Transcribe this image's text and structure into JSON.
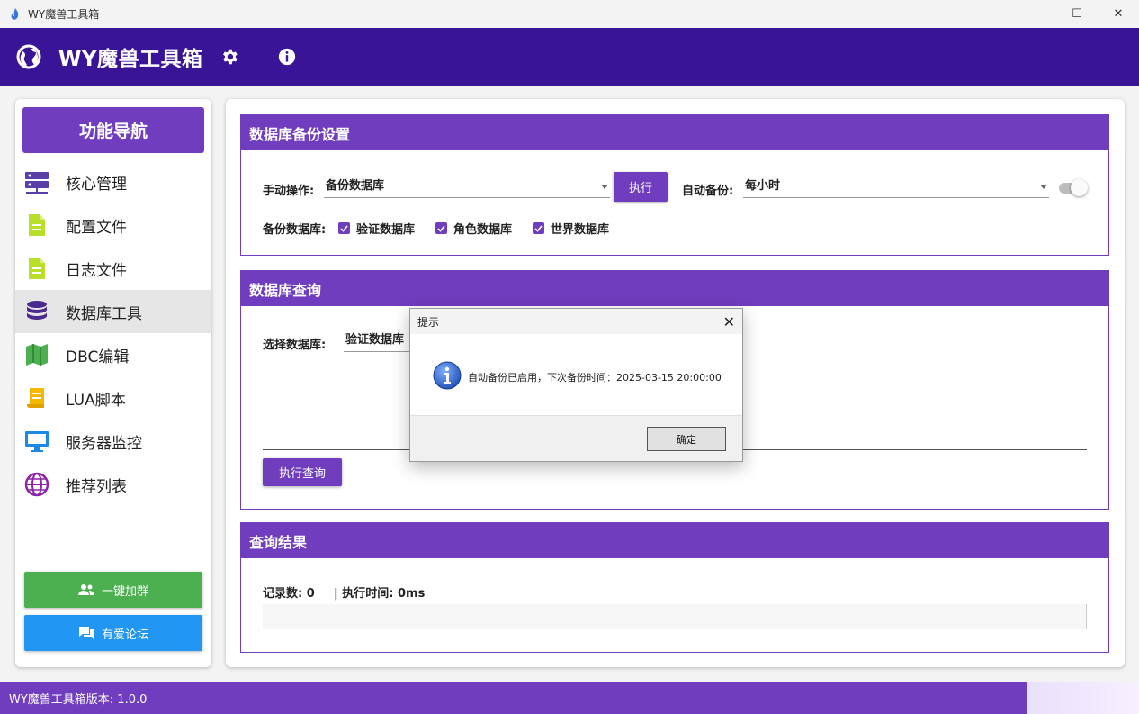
{
  "window": {
    "title": "WY魔兽工具箱",
    "controls": [
      "minimize",
      "maximize",
      "close"
    ]
  },
  "header": {
    "title": "WY魔兽工具箱",
    "color": "#3a1496"
  },
  "sidebar": {
    "heading": "功能导航",
    "items": [
      {
        "label": "核心管理",
        "icon": "server-icon",
        "color": "#5b3fa8"
      },
      {
        "label": "配置文件",
        "icon": "file-icon",
        "color": "#b8e02a"
      },
      {
        "label": "日志文件",
        "icon": "file-icon",
        "color": "#b8e02a"
      },
      {
        "label": "数据库工具",
        "icon": "database-icon",
        "color": "#4a2a8f",
        "active": true
      },
      {
        "label": "DBC编辑",
        "icon": "map-icon",
        "color": "#4caf50"
      },
      {
        "label": "LUA脚本",
        "icon": "script-icon",
        "color": "#f5b800"
      },
      {
        "label": "服务器监控",
        "icon": "monitor-icon",
        "color": "#1e88e5"
      },
      {
        "label": "推荐列表",
        "icon": "globe-icon",
        "color": "#8e24aa"
      }
    ],
    "join_group_label": "一键加群",
    "forum_label": "有爱论坛"
  },
  "backup_panel": {
    "title": "数据库备份设置",
    "manual_label": "手动操作:",
    "manual_value": "备份数据库",
    "execute_label": "执行",
    "auto_label": "自动备份:",
    "auto_value": "每小时",
    "auto_toggle_on": false,
    "db_label": "备份数据库:",
    "checkboxes": [
      {
        "label": "验证数据库",
        "checked": true
      },
      {
        "label": "角色数据库",
        "checked": true
      },
      {
        "label": "世界数据库",
        "checked": true
      }
    ]
  },
  "query_panel": {
    "title": "数据库查询",
    "select_label": "选择数据库:",
    "select_value": "验证数据库",
    "execute_query_label": "执行查询"
  },
  "results_panel": {
    "title": "查询结果",
    "records_text": "记录数: 0",
    "time_text": "| 执行时间: 0ms"
  },
  "statusbar": {
    "version_text": "WY魔兽工具箱版本: 1.0.0"
  },
  "dialog": {
    "title": "提示",
    "message": "自动备份已启用，下次备份时间：2025-03-15 20:00:00",
    "ok_label": "确定"
  },
  "colors": {
    "accent": "#6f3dbe",
    "header": "#3a1496",
    "green": "#4caf50",
    "blue": "#2196f3"
  }
}
